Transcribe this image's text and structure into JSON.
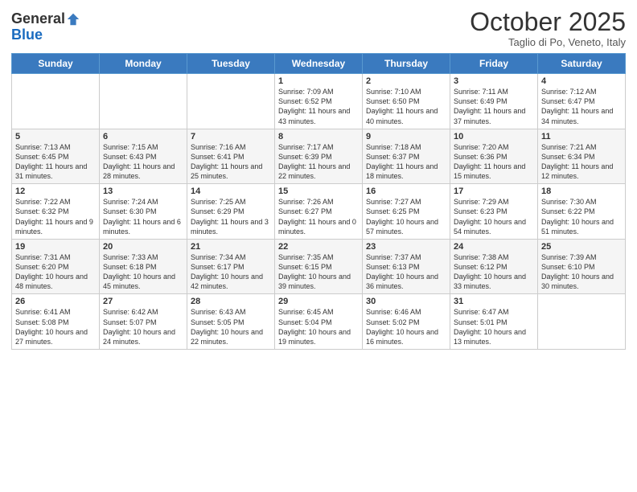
{
  "header": {
    "logo_line1": "General",
    "logo_line2": "Blue",
    "month": "October 2025",
    "location": "Taglio di Po, Veneto, Italy"
  },
  "weekdays": [
    "Sunday",
    "Monday",
    "Tuesday",
    "Wednesday",
    "Thursday",
    "Friday",
    "Saturday"
  ],
  "weeks": [
    [
      {
        "day": "",
        "info": ""
      },
      {
        "day": "",
        "info": ""
      },
      {
        "day": "",
        "info": ""
      },
      {
        "day": "1",
        "info": "Sunrise: 7:09 AM\nSunset: 6:52 PM\nDaylight: 11 hours and 43 minutes."
      },
      {
        "day": "2",
        "info": "Sunrise: 7:10 AM\nSunset: 6:50 PM\nDaylight: 11 hours and 40 minutes."
      },
      {
        "day": "3",
        "info": "Sunrise: 7:11 AM\nSunset: 6:49 PM\nDaylight: 11 hours and 37 minutes."
      },
      {
        "day": "4",
        "info": "Sunrise: 7:12 AM\nSunset: 6:47 PM\nDaylight: 11 hours and 34 minutes."
      }
    ],
    [
      {
        "day": "5",
        "info": "Sunrise: 7:13 AM\nSunset: 6:45 PM\nDaylight: 11 hours and 31 minutes."
      },
      {
        "day": "6",
        "info": "Sunrise: 7:15 AM\nSunset: 6:43 PM\nDaylight: 11 hours and 28 minutes."
      },
      {
        "day": "7",
        "info": "Sunrise: 7:16 AM\nSunset: 6:41 PM\nDaylight: 11 hours and 25 minutes."
      },
      {
        "day": "8",
        "info": "Sunrise: 7:17 AM\nSunset: 6:39 PM\nDaylight: 11 hours and 22 minutes."
      },
      {
        "day": "9",
        "info": "Sunrise: 7:18 AM\nSunset: 6:37 PM\nDaylight: 11 hours and 18 minutes."
      },
      {
        "day": "10",
        "info": "Sunrise: 7:20 AM\nSunset: 6:36 PM\nDaylight: 11 hours and 15 minutes."
      },
      {
        "day": "11",
        "info": "Sunrise: 7:21 AM\nSunset: 6:34 PM\nDaylight: 11 hours and 12 minutes."
      }
    ],
    [
      {
        "day": "12",
        "info": "Sunrise: 7:22 AM\nSunset: 6:32 PM\nDaylight: 11 hours and 9 minutes."
      },
      {
        "day": "13",
        "info": "Sunrise: 7:24 AM\nSunset: 6:30 PM\nDaylight: 11 hours and 6 minutes."
      },
      {
        "day": "14",
        "info": "Sunrise: 7:25 AM\nSunset: 6:29 PM\nDaylight: 11 hours and 3 minutes."
      },
      {
        "day": "15",
        "info": "Sunrise: 7:26 AM\nSunset: 6:27 PM\nDaylight: 11 hours and 0 minutes."
      },
      {
        "day": "16",
        "info": "Sunrise: 7:27 AM\nSunset: 6:25 PM\nDaylight: 10 hours and 57 minutes."
      },
      {
        "day": "17",
        "info": "Sunrise: 7:29 AM\nSunset: 6:23 PM\nDaylight: 10 hours and 54 minutes."
      },
      {
        "day": "18",
        "info": "Sunrise: 7:30 AM\nSunset: 6:22 PM\nDaylight: 10 hours and 51 minutes."
      }
    ],
    [
      {
        "day": "19",
        "info": "Sunrise: 7:31 AM\nSunset: 6:20 PM\nDaylight: 10 hours and 48 minutes."
      },
      {
        "day": "20",
        "info": "Sunrise: 7:33 AM\nSunset: 6:18 PM\nDaylight: 10 hours and 45 minutes."
      },
      {
        "day": "21",
        "info": "Sunrise: 7:34 AM\nSunset: 6:17 PM\nDaylight: 10 hours and 42 minutes."
      },
      {
        "day": "22",
        "info": "Sunrise: 7:35 AM\nSunset: 6:15 PM\nDaylight: 10 hours and 39 minutes."
      },
      {
        "day": "23",
        "info": "Sunrise: 7:37 AM\nSunset: 6:13 PM\nDaylight: 10 hours and 36 minutes."
      },
      {
        "day": "24",
        "info": "Sunrise: 7:38 AM\nSunset: 6:12 PM\nDaylight: 10 hours and 33 minutes."
      },
      {
        "day": "25",
        "info": "Sunrise: 7:39 AM\nSunset: 6:10 PM\nDaylight: 10 hours and 30 minutes."
      }
    ],
    [
      {
        "day": "26",
        "info": "Sunrise: 6:41 AM\nSunset: 5:08 PM\nDaylight: 10 hours and 27 minutes."
      },
      {
        "day": "27",
        "info": "Sunrise: 6:42 AM\nSunset: 5:07 PM\nDaylight: 10 hours and 24 minutes."
      },
      {
        "day": "28",
        "info": "Sunrise: 6:43 AM\nSunset: 5:05 PM\nDaylight: 10 hours and 22 minutes."
      },
      {
        "day": "29",
        "info": "Sunrise: 6:45 AM\nSunset: 5:04 PM\nDaylight: 10 hours and 19 minutes."
      },
      {
        "day": "30",
        "info": "Sunrise: 6:46 AM\nSunset: 5:02 PM\nDaylight: 10 hours and 16 minutes."
      },
      {
        "day": "31",
        "info": "Sunrise: 6:47 AM\nSunset: 5:01 PM\nDaylight: 10 hours and 13 minutes."
      },
      {
        "day": "",
        "info": ""
      }
    ]
  ]
}
